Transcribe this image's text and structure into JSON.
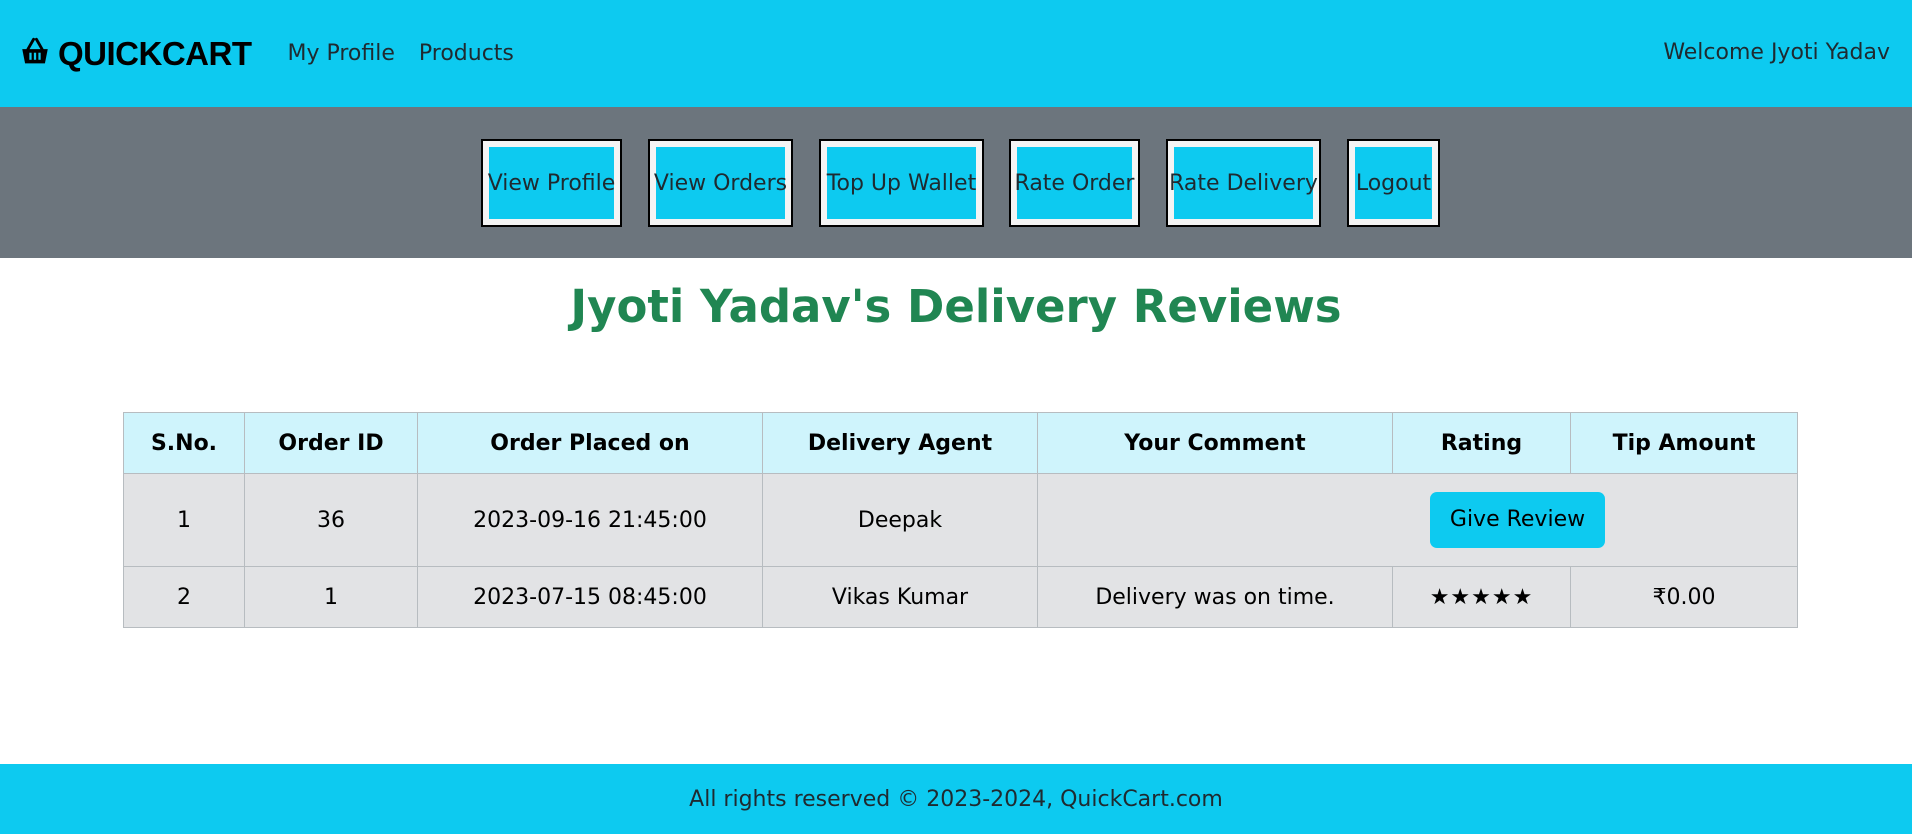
{
  "navbar": {
    "brand": "QUICKCART",
    "brand_icon": "basket-icon",
    "links": [
      {
        "label": "My Profile"
      },
      {
        "label": "Products"
      }
    ],
    "welcome": "Welcome Jyoti Yadav"
  },
  "actions": [
    {
      "label": "View Profile"
    },
    {
      "label": "View Orders"
    },
    {
      "label": "Top Up Wallet"
    },
    {
      "label": "Rate Order"
    },
    {
      "label": "Rate Delivery"
    },
    {
      "label": "Logout"
    }
  ],
  "page_title": "Jyoti Yadav's Delivery Reviews",
  "table": {
    "headers": [
      "S.No.",
      "Order ID",
      "Order Placed on",
      "Delivery Agent",
      "Your Comment",
      "Rating",
      "Tip Amount"
    ],
    "rows": [
      {
        "sno": "1",
        "order_id": "36",
        "placed_on": "2023-09-16 21:45:00",
        "agent": "Deepak",
        "action_label": "Give Review"
      },
      {
        "sno": "2",
        "order_id": "1",
        "placed_on": "2023-07-15 08:45:00",
        "agent": "Vikas Kumar",
        "comment": "Delivery was on time.",
        "rating": "★★★★★",
        "rating_value": 5,
        "tip": "₹0.00"
      }
    ]
  },
  "footer": {
    "text": "All rights reserved © 2023-2024, QuickCart.com"
  },
  "colors": {
    "primary": "#0dcaf0",
    "action_bar": "#6c757d",
    "title": "#208652",
    "table_header": "#cff4fc",
    "table_row": "#e2e3e5"
  }
}
